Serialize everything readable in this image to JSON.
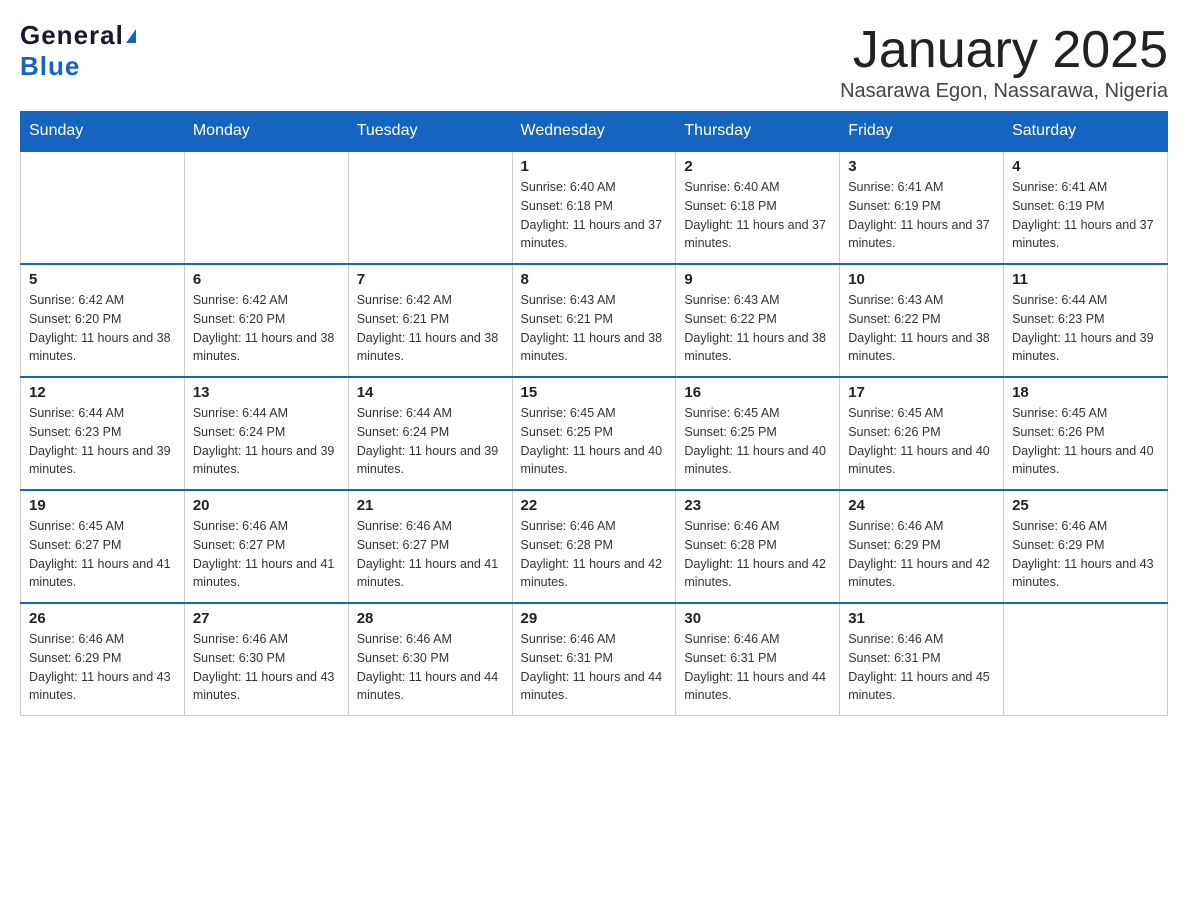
{
  "logo": {
    "general": "General",
    "blue": "Blue"
  },
  "title": "January 2025",
  "location": "Nasarawa Egon, Nassarawa, Nigeria",
  "days_of_week": [
    "Sunday",
    "Monday",
    "Tuesday",
    "Wednesday",
    "Thursday",
    "Friday",
    "Saturday"
  ],
  "weeks": [
    [
      {
        "day": "",
        "info": ""
      },
      {
        "day": "",
        "info": ""
      },
      {
        "day": "",
        "info": ""
      },
      {
        "day": "1",
        "info": "Sunrise: 6:40 AM\nSunset: 6:18 PM\nDaylight: 11 hours and 37 minutes."
      },
      {
        "day": "2",
        "info": "Sunrise: 6:40 AM\nSunset: 6:18 PM\nDaylight: 11 hours and 37 minutes."
      },
      {
        "day": "3",
        "info": "Sunrise: 6:41 AM\nSunset: 6:19 PM\nDaylight: 11 hours and 37 minutes."
      },
      {
        "day": "4",
        "info": "Sunrise: 6:41 AM\nSunset: 6:19 PM\nDaylight: 11 hours and 37 minutes."
      }
    ],
    [
      {
        "day": "5",
        "info": "Sunrise: 6:42 AM\nSunset: 6:20 PM\nDaylight: 11 hours and 38 minutes."
      },
      {
        "day": "6",
        "info": "Sunrise: 6:42 AM\nSunset: 6:20 PM\nDaylight: 11 hours and 38 minutes."
      },
      {
        "day": "7",
        "info": "Sunrise: 6:42 AM\nSunset: 6:21 PM\nDaylight: 11 hours and 38 minutes."
      },
      {
        "day": "8",
        "info": "Sunrise: 6:43 AM\nSunset: 6:21 PM\nDaylight: 11 hours and 38 minutes."
      },
      {
        "day": "9",
        "info": "Sunrise: 6:43 AM\nSunset: 6:22 PM\nDaylight: 11 hours and 38 minutes."
      },
      {
        "day": "10",
        "info": "Sunrise: 6:43 AM\nSunset: 6:22 PM\nDaylight: 11 hours and 38 minutes."
      },
      {
        "day": "11",
        "info": "Sunrise: 6:44 AM\nSunset: 6:23 PM\nDaylight: 11 hours and 39 minutes."
      }
    ],
    [
      {
        "day": "12",
        "info": "Sunrise: 6:44 AM\nSunset: 6:23 PM\nDaylight: 11 hours and 39 minutes."
      },
      {
        "day": "13",
        "info": "Sunrise: 6:44 AM\nSunset: 6:24 PM\nDaylight: 11 hours and 39 minutes."
      },
      {
        "day": "14",
        "info": "Sunrise: 6:44 AM\nSunset: 6:24 PM\nDaylight: 11 hours and 39 minutes."
      },
      {
        "day": "15",
        "info": "Sunrise: 6:45 AM\nSunset: 6:25 PM\nDaylight: 11 hours and 40 minutes."
      },
      {
        "day": "16",
        "info": "Sunrise: 6:45 AM\nSunset: 6:25 PM\nDaylight: 11 hours and 40 minutes."
      },
      {
        "day": "17",
        "info": "Sunrise: 6:45 AM\nSunset: 6:26 PM\nDaylight: 11 hours and 40 minutes."
      },
      {
        "day": "18",
        "info": "Sunrise: 6:45 AM\nSunset: 6:26 PM\nDaylight: 11 hours and 40 minutes."
      }
    ],
    [
      {
        "day": "19",
        "info": "Sunrise: 6:45 AM\nSunset: 6:27 PM\nDaylight: 11 hours and 41 minutes."
      },
      {
        "day": "20",
        "info": "Sunrise: 6:46 AM\nSunset: 6:27 PM\nDaylight: 11 hours and 41 minutes."
      },
      {
        "day": "21",
        "info": "Sunrise: 6:46 AM\nSunset: 6:27 PM\nDaylight: 11 hours and 41 minutes."
      },
      {
        "day": "22",
        "info": "Sunrise: 6:46 AM\nSunset: 6:28 PM\nDaylight: 11 hours and 42 minutes."
      },
      {
        "day": "23",
        "info": "Sunrise: 6:46 AM\nSunset: 6:28 PM\nDaylight: 11 hours and 42 minutes."
      },
      {
        "day": "24",
        "info": "Sunrise: 6:46 AM\nSunset: 6:29 PM\nDaylight: 11 hours and 42 minutes."
      },
      {
        "day": "25",
        "info": "Sunrise: 6:46 AM\nSunset: 6:29 PM\nDaylight: 11 hours and 43 minutes."
      }
    ],
    [
      {
        "day": "26",
        "info": "Sunrise: 6:46 AM\nSunset: 6:29 PM\nDaylight: 11 hours and 43 minutes."
      },
      {
        "day": "27",
        "info": "Sunrise: 6:46 AM\nSunset: 6:30 PM\nDaylight: 11 hours and 43 minutes."
      },
      {
        "day": "28",
        "info": "Sunrise: 6:46 AM\nSunset: 6:30 PM\nDaylight: 11 hours and 44 minutes."
      },
      {
        "day": "29",
        "info": "Sunrise: 6:46 AM\nSunset: 6:31 PM\nDaylight: 11 hours and 44 minutes."
      },
      {
        "day": "30",
        "info": "Sunrise: 6:46 AM\nSunset: 6:31 PM\nDaylight: 11 hours and 44 minutes."
      },
      {
        "day": "31",
        "info": "Sunrise: 6:46 AM\nSunset: 6:31 PM\nDaylight: 11 hours and 45 minutes."
      },
      {
        "day": "",
        "info": ""
      }
    ]
  ]
}
